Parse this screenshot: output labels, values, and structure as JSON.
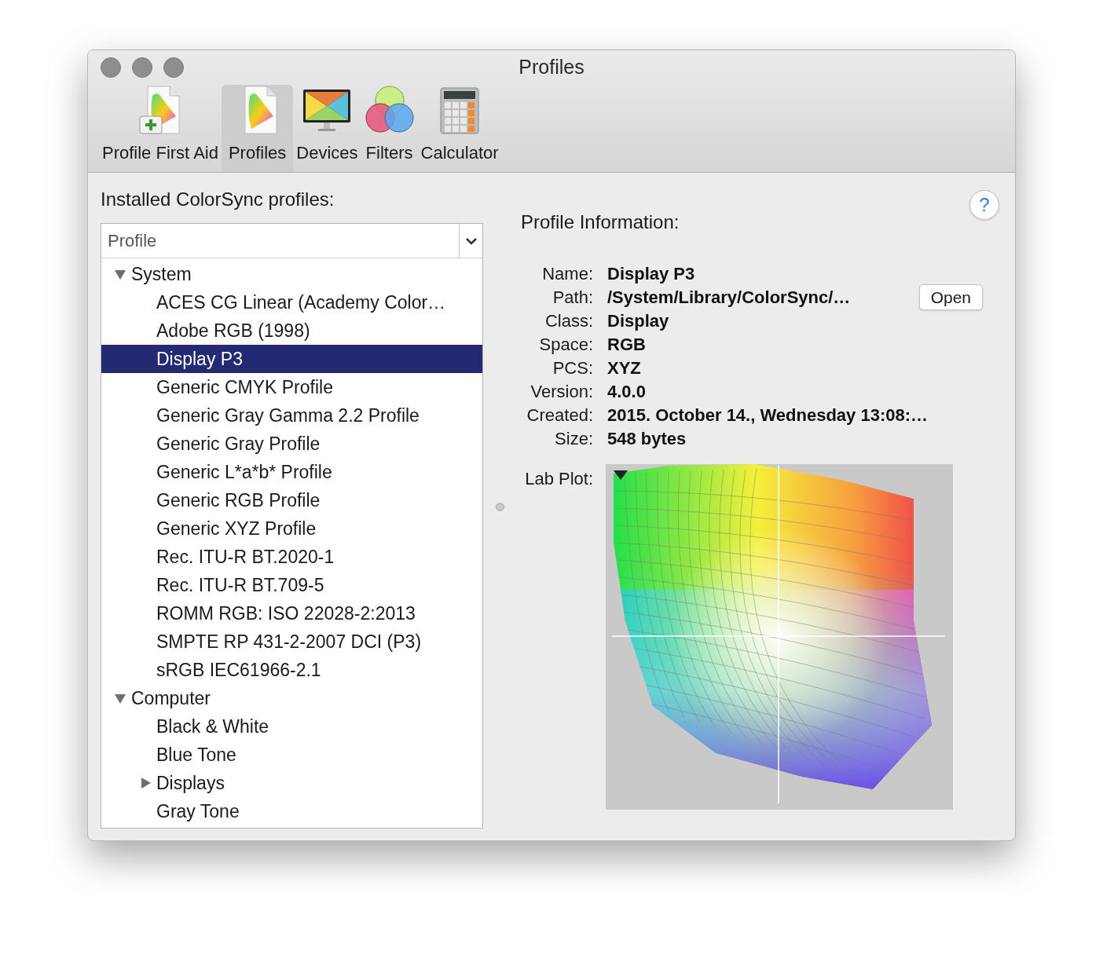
{
  "window": {
    "title": "Profiles"
  },
  "toolbar": [
    {
      "label": "Profile First Aid",
      "selected": false
    },
    {
      "label": "Profiles",
      "selected": true
    },
    {
      "label": "Devices",
      "selected": false
    },
    {
      "label": "Filters",
      "selected": false
    },
    {
      "label": "Calculator",
      "selected": false
    }
  ],
  "profiles_panel": {
    "heading": "Installed ColorSync profiles:",
    "column_header": "Profile",
    "tree": [
      {
        "label": "System",
        "expanded": true,
        "selected": false,
        "children": [
          {
            "label": "ACES CG Linear (Academy Color…",
            "selected": false
          },
          {
            "label": "Adobe RGB (1998)",
            "selected": false
          },
          {
            "label": "Display P3",
            "selected": true
          },
          {
            "label": "Generic CMYK Profile",
            "selected": false
          },
          {
            "label": "Generic Gray Gamma 2.2 Profile",
            "selected": false
          },
          {
            "label": "Generic Gray Profile",
            "selected": false
          },
          {
            "label": "Generic L*a*b* Profile",
            "selected": false
          },
          {
            "label": "Generic RGB Profile",
            "selected": false
          },
          {
            "label": "Generic XYZ Profile",
            "selected": false
          },
          {
            "label": "Rec. ITU-R BT.2020-1",
            "selected": false
          },
          {
            "label": "Rec. ITU-R BT.709-5",
            "selected": false
          },
          {
            "label": "ROMM RGB: ISO 22028-2:2013",
            "selected": false
          },
          {
            "label": "SMPTE RP 431-2-2007 DCI (P3)",
            "selected": false
          },
          {
            "label": "sRGB IEC61966-2.1",
            "selected": false
          }
        ]
      },
      {
        "label": "Computer",
        "expanded": true,
        "selected": false,
        "children": [
          {
            "label": "Black & White",
            "selected": false
          },
          {
            "label": "Blue Tone",
            "selected": false
          },
          {
            "label": "Displays",
            "expanded": false,
            "selected": false
          },
          {
            "label": "Gray Tone",
            "selected": false
          }
        ]
      }
    ]
  },
  "info_panel": {
    "heading": "Profile Information:",
    "help": "?",
    "fields": [
      {
        "label": "Name:",
        "value": "Display P3"
      },
      {
        "label": "Path:",
        "value": "/System/Library/ColorSync/…",
        "button": "Open"
      },
      {
        "label": "Class:",
        "value": "Display"
      },
      {
        "label": "Space:",
        "value": "RGB"
      },
      {
        "label": "PCS:",
        "value": "XYZ"
      },
      {
        "label": "Version:",
        "value": "4.0.0"
      },
      {
        "label": "Created:",
        "value": "2015. October 14., Wednesday 13:08:…"
      },
      {
        "label": "Size:",
        "value": "548 bytes"
      }
    ],
    "plot_label": "Lab Plot:"
  }
}
